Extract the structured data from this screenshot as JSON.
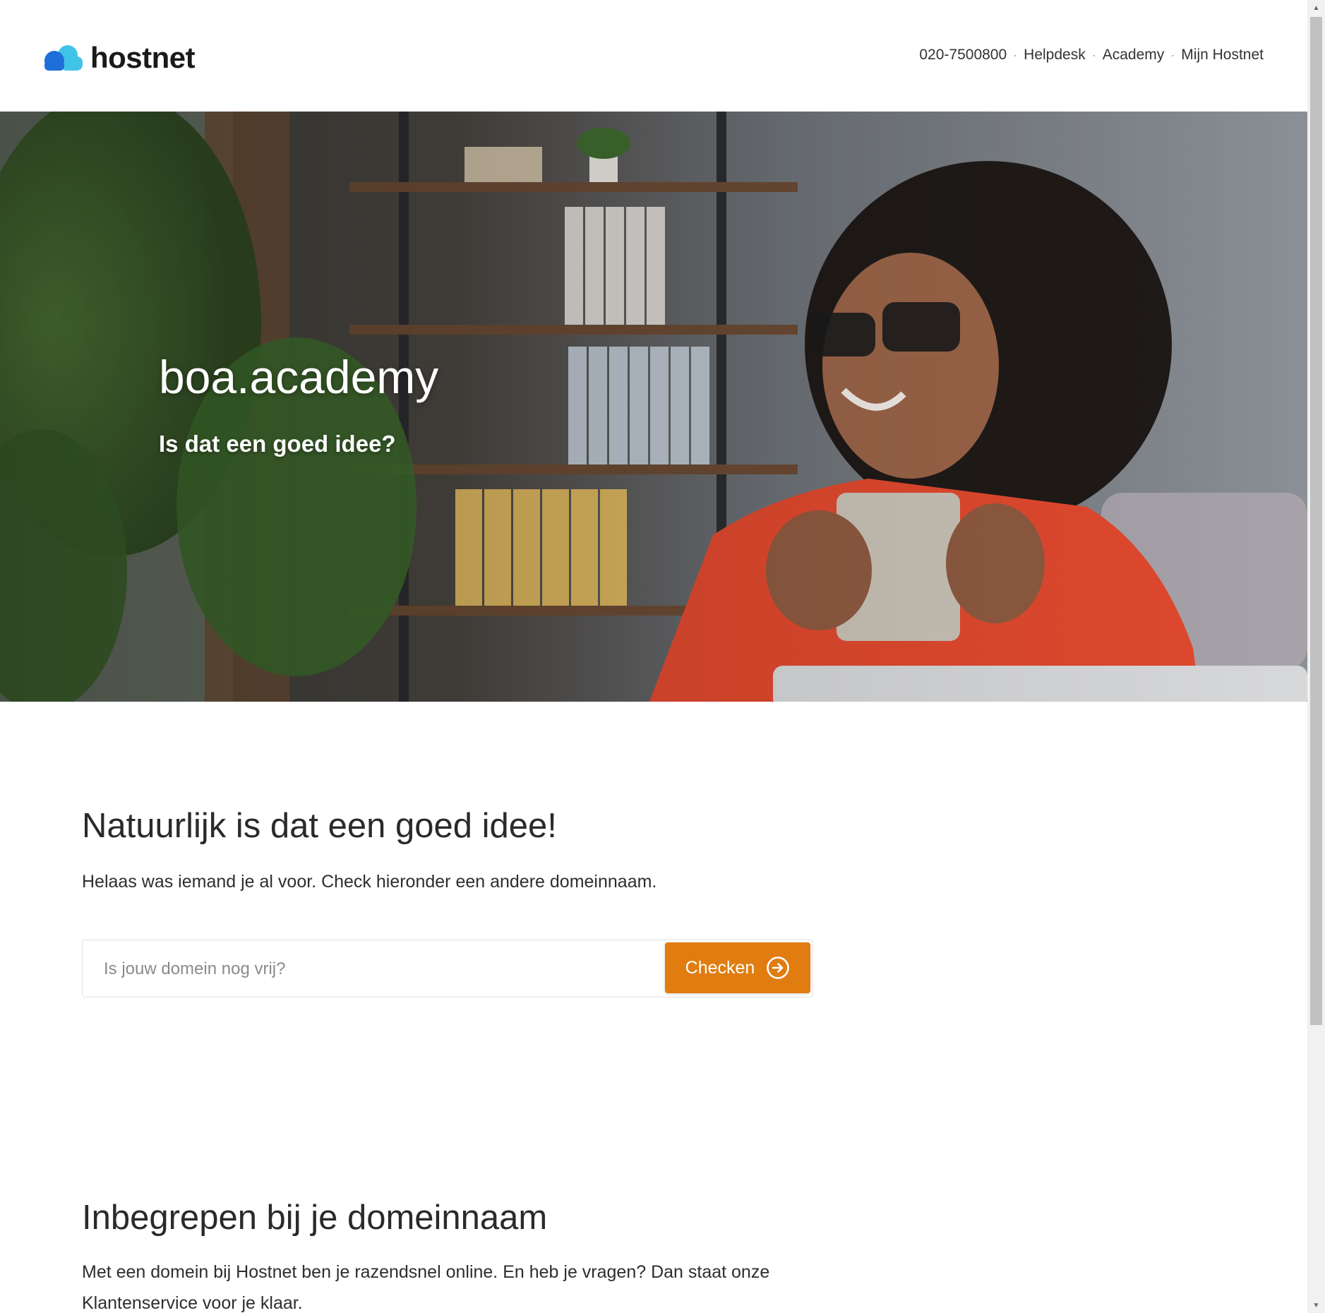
{
  "brand": {
    "name": "hostnet",
    "color_primary": "#1f6fd8",
    "color_secondary": "#3fc4e8"
  },
  "nav": {
    "items": [
      {
        "label": "020-7500800"
      },
      {
        "label": "Helpdesk"
      },
      {
        "label": "Academy"
      },
      {
        "label": "Mijn Hostnet"
      }
    ],
    "separator": "·"
  },
  "hero": {
    "domain": "boa.academy",
    "question": "Is dat een goed idee?"
  },
  "result": {
    "heading": "Natuurlijk is dat een goed idee!",
    "text": "Helaas was iemand je al voor. Check hieronder een andere domeinnaam."
  },
  "search": {
    "placeholder": "Is jouw domein nog vrij?",
    "value": "",
    "button_label": "Checken",
    "button_color": "#e07c10"
  },
  "included": {
    "heading": "Inbegrepen bij je domeinnaam",
    "text_line1": "Met een domein bij Hostnet ben je razendsnel online. En heb je vragen? Dan staat onze",
    "text_line2": "Klantenservice voor je klaar."
  }
}
